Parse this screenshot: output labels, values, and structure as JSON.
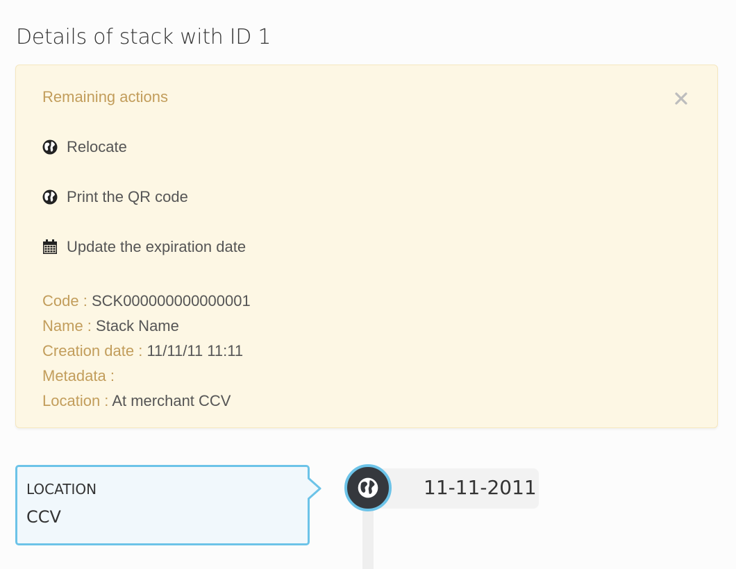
{
  "page": {
    "title": "Details of stack with ID 1"
  },
  "alert": {
    "heading": "Remaining actions",
    "actions": [
      {
        "label": "Relocate",
        "icon": "globe-icon"
      },
      {
        "label": "Print the QR code",
        "icon": "globe-icon"
      },
      {
        "label": "Update the expiration date",
        "icon": "calendar-icon"
      }
    ],
    "details": {
      "code_label": "Code :",
      "code_value": "SCK000000000000001",
      "name_label": "Name :",
      "name_value": "Stack Name",
      "creation_label": "Creation date :",
      "creation_value": "11/11/11 11:11",
      "metadata_label": "Metadata :",
      "metadata_value": "",
      "location_label": "Location :",
      "location_value": "At merchant CCV"
    }
  },
  "timeline": {
    "card_title": "LOCATION",
    "card_value": "CCV",
    "date": "11-11-2011",
    "icon": "globe-icon"
  },
  "colors": {
    "alert_bg": "#fdf7e4",
    "alert_accent": "#c29d5b",
    "timeline_accent": "#6cc3e8",
    "badge_bg": "#35383d"
  }
}
